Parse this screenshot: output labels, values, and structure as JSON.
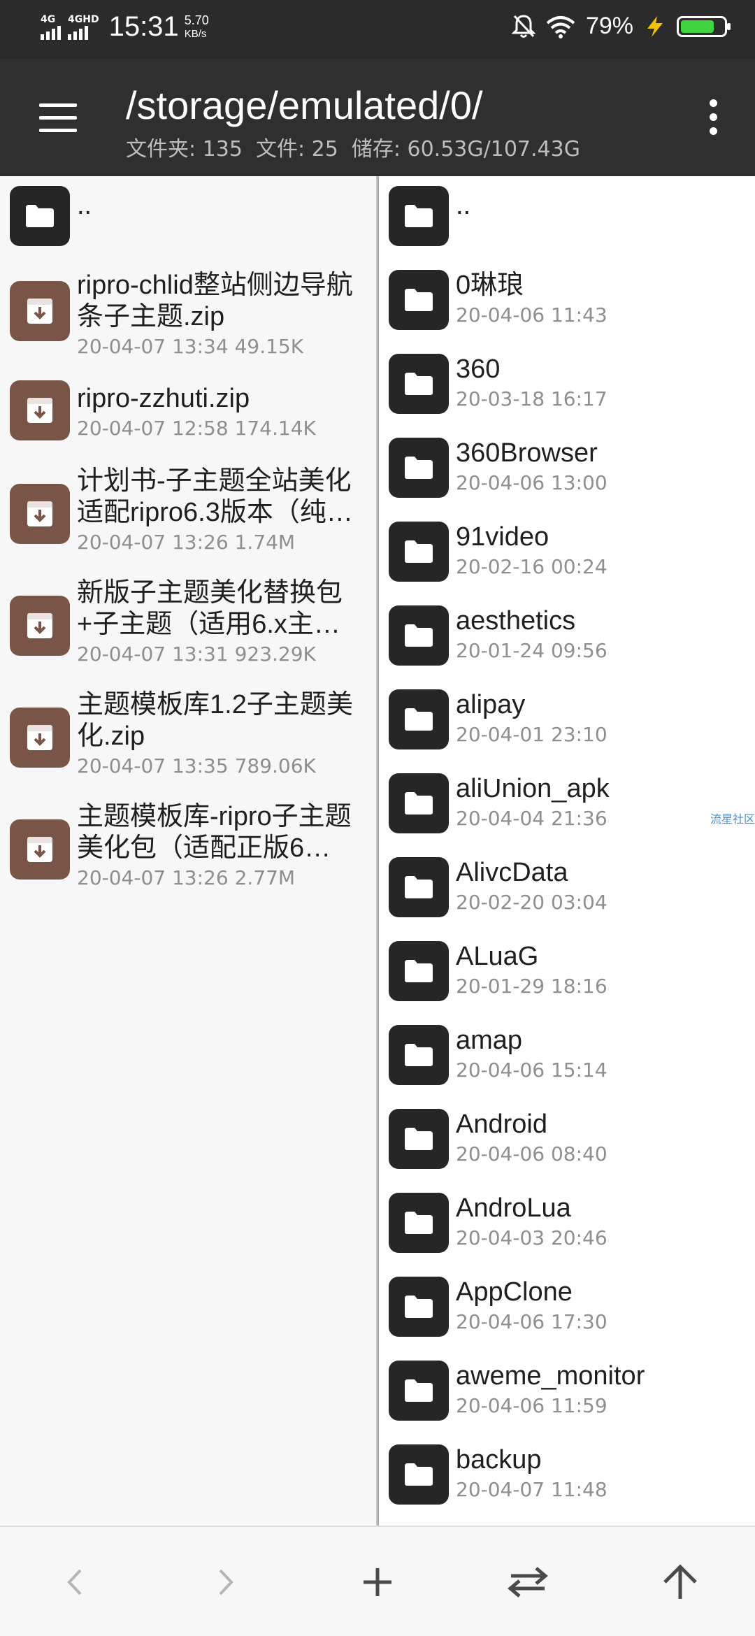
{
  "status_bar": {
    "network_1": "4G",
    "network_2": "4GHD",
    "time": "15:31",
    "speed_value": "5.70",
    "speed_unit": "KB/s",
    "battery_percent": "79%",
    "battery_level": 0.79,
    "icons": [
      "mute-icon",
      "wifi-icon",
      "charging-icon",
      "battery-icon"
    ]
  },
  "header": {
    "path": "/storage/emulated/0/",
    "summary": "文件夹: 135  文件: 25  储存: 60.53G/107.43G"
  },
  "left_pane": {
    "items": [
      {
        "type": "folder",
        "name": "..",
        "meta": ""
      },
      {
        "type": "zip",
        "name": "ripro-chlid整站侧边导航条子主题.zip",
        "meta": "20-04-07 13:34  49.15K"
      },
      {
        "type": "zip",
        "name": "ripro-zzhuti.zip",
        "meta": "20-04-07 12:58  174.14K"
      },
      {
        "type": "zip",
        "name": "计划书-子主题全站美化适配ripro6.3版本（纯…",
        "meta": "20-04-07 13:26  1.74M"
      },
      {
        "type": "zip",
        "name": "新版子主题美化替换包+子主题（适用6.x主…",
        "meta": "20-04-07 13:31  923.29K"
      },
      {
        "type": "zip",
        "name": "主题模板库1.2子主题美化.zip",
        "meta": "20-04-07 13:35  789.06K"
      },
      {
        "type": "zip",
        "name": "主题模板库-ripro子主题美化包（适配正版6…",
        "meta": "20-04-07 13:26  2.77M"
      }
    ]
  },
  "right_pane": {
    "items": [
      {
        "name": "..",
        "meta": ""
      },
      {
        "name": "0琳琅",
        "meta": "20-04-06 11:43"
      },
      {
        "name": "360",
        "meta": "20-03-18 16:17"
      },
      {
        "name": "360Browser",
        "meta": "20-04-06 13:00"
      },
      {
        "name": "91video",
        "meta": "20-02-16 00:24"
      },
      {
        "name": "aesthetics",
        "meta": "20-01-24 09:56"
      },
      {
        "name": "alipay",
        "meta": "20-04-01 23:10"
      },
      {
        "name": "aliUnion_apk",
        "meta": "20-04-04 21:36"
      },
      {
        "name": "AlivcData",
        "meta": "20-02-20 03:04"
      },
      {
        "name": "ALuaG",
        "meta": "20-01-29 18:16"
      },
      {
        "name": "amap",
        "meta": "20-04-06 15:14"
      },
      {
        "name": "Android",
        "meta": "20-04-06 08:40"
      },
      {
        "name": "AndroLua",
        "meta": "20-04-03 20:46"
      },
      {
        "name": "AppClone",
        "meta": "20-04-06 17:30"
      },
      {
        "name": "aweme_monitor",
        "meta": "20-04-06 11:59"
      },
      {
        "name": "backup",
        "meta": "20-04-07 11:48"
      }
    ]
  },
  "watermark": "流星社区",
  "bottom_bar": {
    "buttons": [
      "back-icon",
      "forward-icon",
      "add-icon",
      "swap-icon",
      "up-icon"
    ]
  }
}
